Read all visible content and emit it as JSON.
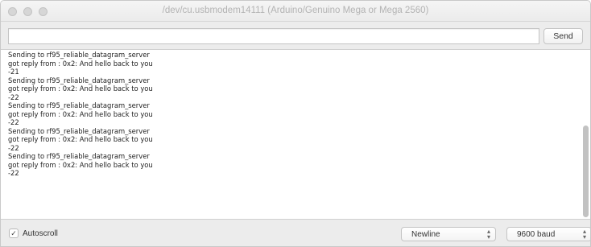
{
  "window": {
    "title": "/dev/cu.usbmodem14111 (Arduino/Genuino Mega or Mega 2560)"
  },
  "input": {
    "value": "",
    "placeholder": ""
  },
  "send_button": {
    "label": "Send"
  },
  "output": {
    "lines": [
      "Sending to rf95_reliable_datagram_server",
      "got reply from : 0x2: And hello back to you",
      "-21",
      "Sending to rf95_reliable_datagram_server",
      "got reply from : 0x2: And hello back to you",
      "-22",
      "Sending to rf95_reliable_datagram_server",
      "got reply from : 0x2: And hello back to you",
      "-22",
      "Sending to rf95_reliable_datagram_server",
      "got reply from : 0x2: And hello back to you",
      "-22",
      "Sending to rf95_reliable_datagram_server",
      "got reply from : 0x2: And hello back to you",
      "-22"
    ]
  },
  "footer": {
    "autoscroll_label": "Autoscroll",
    "autoscroll_checked": true,
    "checkmark": "✓",
    "line_ending_selected": "Newline",
    "baud_selected": "9600 baud",
    "chevron_up": "▴",
    "chevron_down": "▾"
  }
}
